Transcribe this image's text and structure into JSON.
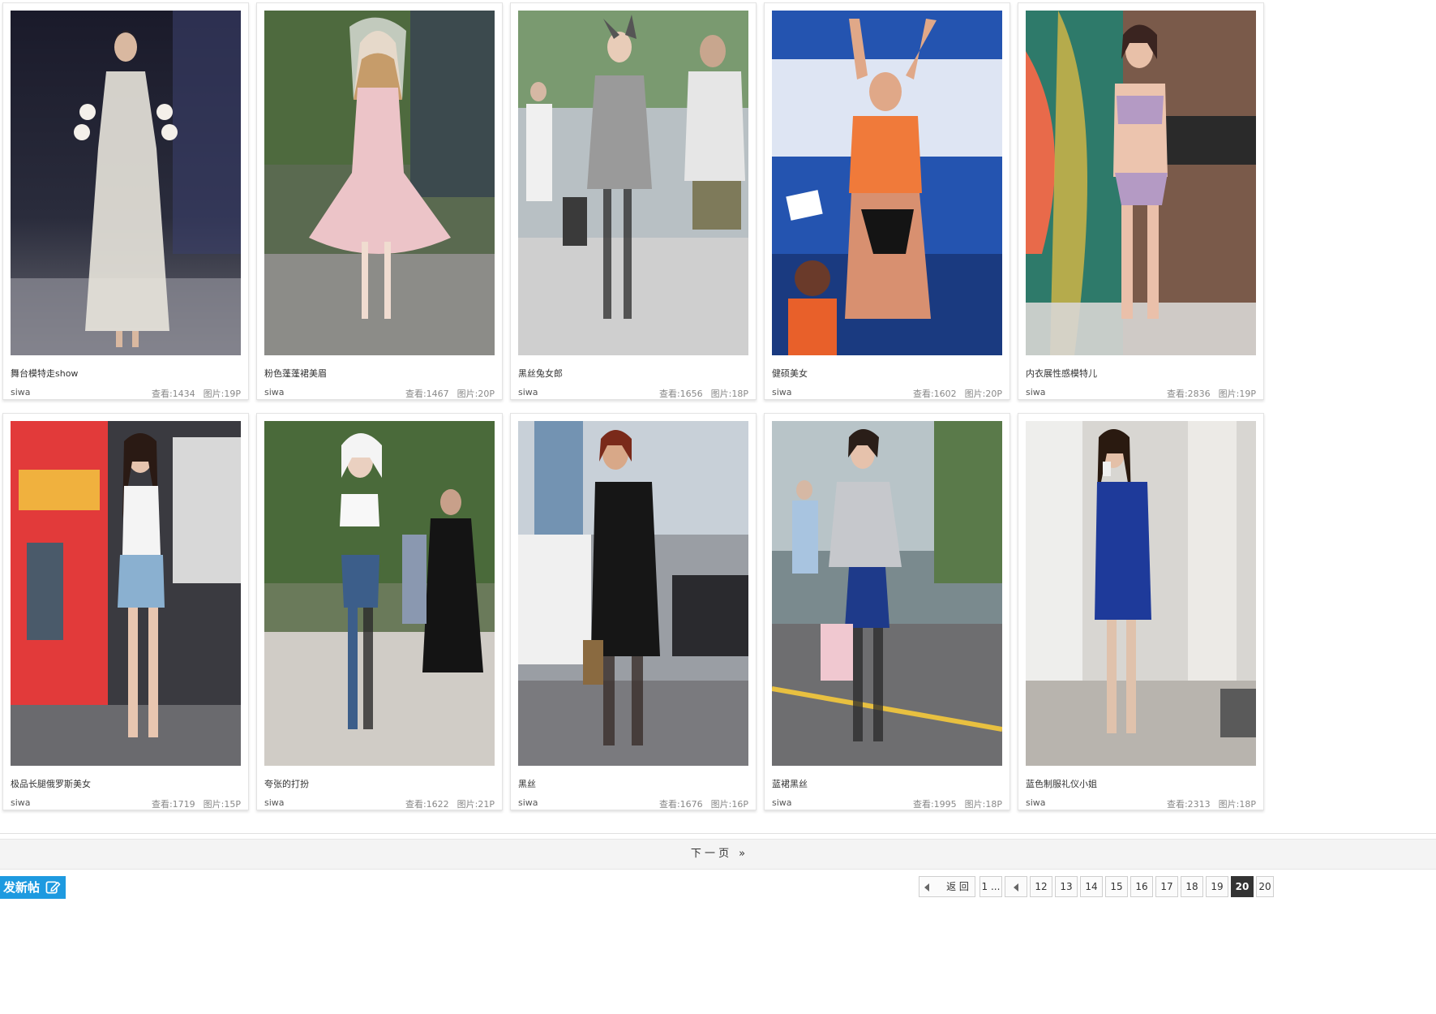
{
  "cards": [
    {
      "title": "舞台模特走show",
      "author": "siwa",
      "views": "查看:1434",
      "pics": "图片:19P",
      "image": "runway-model-white-lace-dress"
    },
    {
      "title": "粉色蓬蓬裙美眉",
      "author": "siwa",
      "views": "查看:1467",
      "pics": "图片:20P",
      "image": "girl-in-pink-lolita-dress"
    },
    {
      "title": "黑丝兔女郎",
      "author": "siwa",
      "views": "查看:1656",
      "pics": "图片:18P",
      "image": "bunny-ears-girl-street"
    },
    {
      "title": "健硕美女",
      "author": "siwa",
      "views": "查看:1602",
      "pics": "图片:20P",
      "image": "fitness-contestant-orange-top"
    },
    {
      "title": "内衣展性感模特儿",
      "author": "siwa",
      "views": "查看:2836",
      "pics": "图片:19P",
      "image": "lingerie-show-model"
    },
    {
      "title": "极品长腿俄罗斯美女",
      "author": "siwa",
      "views": "查看:1719",
      "pics": "图片:15P",
      "image": "model-at-expo-booth"
    },
    {
      "title": "夸张的打扮",
      "author": "siwa",
      "views": "查看:1622",
      "pics": "图片:21P",
      "image": "white-hair-girl-street"
    },
    {
      "title": "黑丝",
      "author": "siwa",
      "views": "查看:1676",
      "pics": "图片:16P",
      "image": "woman-black-dress-street"
    },
    {
      "title": "蓝裙黑丝",
      "author": "siwa",
      "views": "查看:1995",
      "pics": "图片:18P",
      "image": "woman-blue-skirt-tweed-jacket"
    },
    {
      "title": "蓝色制服礼仪小姐",
      "author": "siwa",
      "views": "查看:2313",
      "pics": "图片:18P",
      "image": "hostess-blue-uniform-phone"
    }
  ],
  "next_page": {
    "label": "下 一 页",
    "arrow": "»"
  },
  "new_post": {
    "label": "发新帖",
    "icon": "edit-pen-icon"
  },
  "pager": {
    "back_label": "返 回",
    "first_label": "1 ...",
    "pages": [
      "12",
      "13",
      "14",
      "15",
      "16",
      "17",
      "18",
      "19"
    ],
    "current": "20",
    "jump_value": "20"
  },
  "colors": {
    "new_post_bg": "#1e9ae0",
    "current_page_bg": "#333333"
  }
}
